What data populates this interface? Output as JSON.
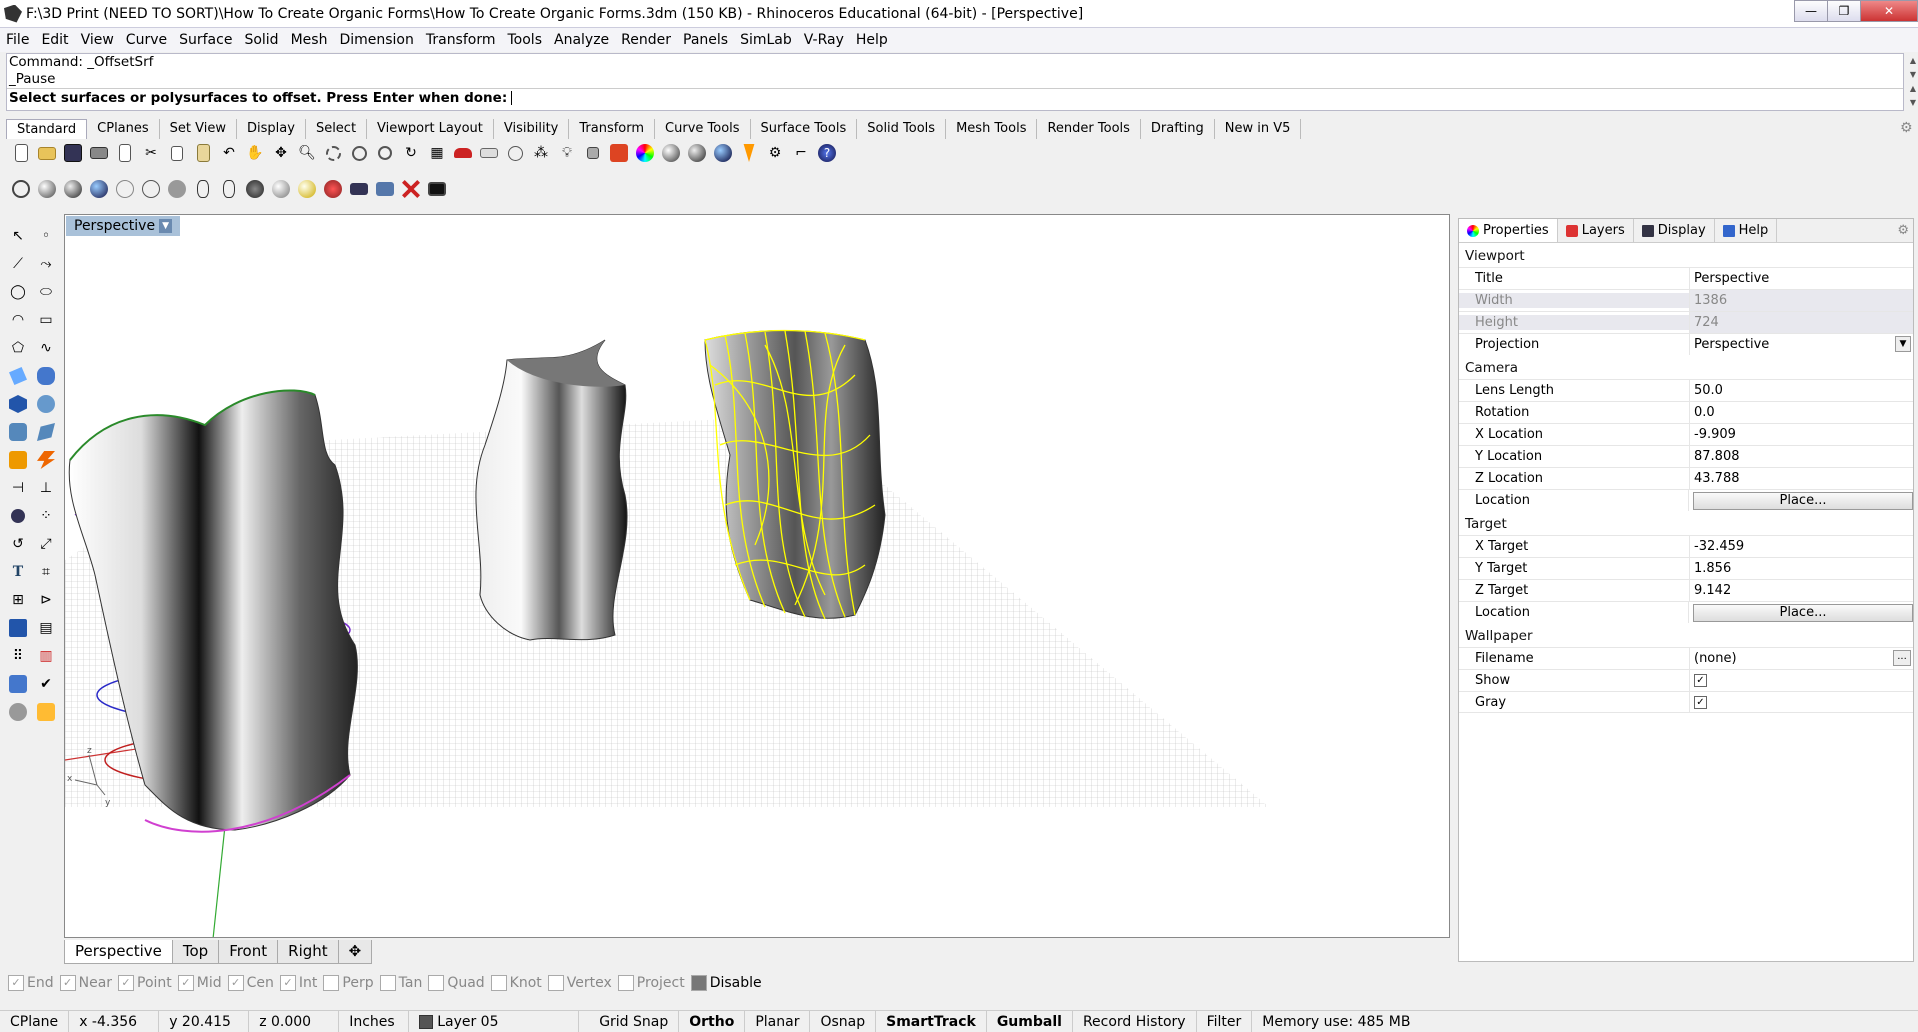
{
  "window": {
    "title": "F:\\3D Print (NEED TO SORT)\\How To Create Organic Forms\\How To Create Organic Forms.3dm (150 KB) - Rhinoceros Educational (64-bit) - [Perspective]"
  },
  "menu": [
    "File",
    "Edit",
    "View",
    "Curve",
    "Surface",
    "Solid",
    "Mesh",
    "Dimension",
    "Transform",
    "Tools",
    "Analyze",
    "Render",
    "Panels",
    "SimLab",
    "V-Ray",
    "Help"
  ],
  "command": {
    "history1": "Command: _OffsetSrf",
    "history2": "_Pause",
    "prompt": "Select surfaces or polysurfaces to offset. Press Enter when done:"
  },
  "tabs": [
    "Standard",
    "CPlanes",
    "Set View",
    "Display",
    "Select",
    "Viewport Layout",
    "Visibility",
    "Transform",
    "Curve Tools",
    "Surface Tools",
    "Solid Tools",
    "Mesh Tools",
    "Render Tools",
    "Drafting",
    "New in V5"
  ],
  "viewport": {
    "title": "Perspective",
    "tabs": [
      "Perspective",
      "Top",
      "Front",
      "Right"
    ]
  },
  "panel": {
    "tabs": [
      "Properties",
      "Layers",
      "Display",
      "Help"
    ],
    "sections": {
      "viewport": "Viewport",
      "camera": "Camera",
      "target": "Target",
      "wallpaper": "Wallpaper"
    },
    "viewport_rows": [
      {
        "k": "Title",
        "v": "Perspective"
      },
      {
        "k": "Width",
        "v": "1386"
      },
      {
        "k": "Height",
        "v": "724"
      },
      {
        "k": "Projection",
        "v": "Perspective"
      }
    ],
    "camera_rows": [
      {
        "k": "Lens Length",
        "v": "50.0"
      },
      {
        "k": "Rotation",
        "v": "0.0"
      },
      {
        "k": "X Location",
        "v": "-9.909"
      },
      {
        "k": "Y Location",
        "v": "87.808"
      },
      {
        "k": "Z Location",
        "v": "43.788"
      },
      {
        "k": "Location",
        "v": "Place..."
      }
    ],
    "target_rows": [
      {
        "k": "X Target",
        "v": "-32.459"
      },
      {
        "k": "Y Target",
        "v": "1.856"
      },
      {
        "k": "Z Target",
        "v": "9.142"
      },
      {
        "k": "Location",
        "v": "Place..."
      }
    ],
    "wallpaper_rows": [
      {
        "k": "Filename",
        "v": "(none)"
      },
      {
        "k": "Show",
        "v": "✓"
      },
      {
        "k": "Gray",
        "v": "✓"
      }
    ]
  },
  "osnaps": [
    {
      "label": "End",
      "on": false
    },
    {
      "label": "Near",
      "on": false
    },
    {
      "label": "Point",
      "on": false
    },
    {
      "label": "Mid",
      "on": false
    },
    {
      "label": "Cen",
      "on": false
    },
    {
      "label": "Int",
      "on": false
    },
    {
      "label": "Perp",
      "on": false
    },
    {
      "label": "Tan",
      "on": false
    },
    {
      "label": "Quad",
      "on": false
    },
    {
      "label": "Knot",
      "on": false
    },
    {
      "label": "Vertex",
      "on": false
    },
    {
      "label": "Project",
      "on": false
    },
    {
      "label": "Disable",
      "on": true
    }
  ],
  "status": {
    "cplane": "CPlane",
    "x": "x -4.356",
    "y": "y 20.415",
    "z": "z 0.000",
    "units": "Inches",
    "layer": "Layer 05",
    "grid_snap": "Grid Snap",
    "ortho": "Ortho",
    "planar": "Planar",
    "osnap": "Osnap",
    "smarttrack": "SmartTrack",
    "gumball": "Gumball",
    "record_history": "Record History",
    "filter": "Filter",
    "memory": "Memory use: 485 MB"
  },
  "colors": {
    "viewport_title_bg": "#a9c1d9",
    "selection_yellow": "#ffff00",
    "grid": "#c8c8c8"
  }
}
